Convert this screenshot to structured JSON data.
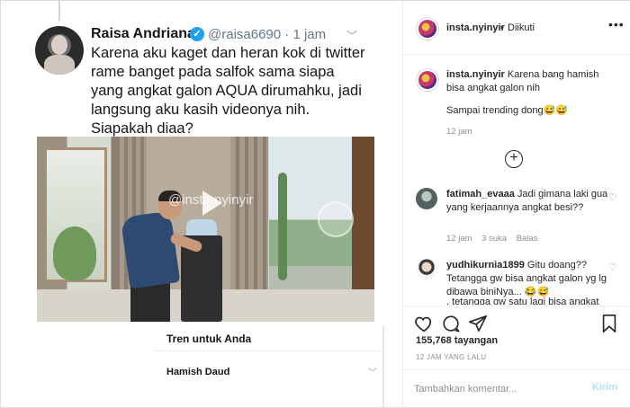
{
  "tweet": {
    "name": "Raisa Andriana",
    "handle": "@raisa6690 · 1 jam",
    "text": "Karena aku kaget dan heran kok di twitter rame banget pada salfok sama siapa yang angkat galon AQUA dirumahku, jadi langsung aku kasih videonya nih. Siapakah diaa?",
    "video_watermark": "@insta.nyinyir"
  },
  "trends": {
    "title": "Tren untuk Anda",
    "item": "Hamish Daud"
  },
  "header": {
    "username": "insta.nyinyir",
    "separator": "•",
    "follow_status": "Diikuti",
    "more": "•••"
  },
  "caption": {
    "username": "insta.nyinyir",
    "text": "Karena bang hamish bisa angkat galon nih",
    "extra": "Sampai trending dong😅😅",
    "time": "12 jam"
  },
  "comments": [
    {
      "username": "fatimah_evaaa",
      "text": "Jadi gimana laki gua yang kerjaannya angkat besi??",
      "time": "12 jam",
      "likes": "3 suka",
      "reply": "Balas"
    },
    {
      "username": "yudhikurnia1899",
      "text": "Gitu doang?? Tetangga gw bisa angkat galon yg lg dibawa biniNya... 😂😅",
      "overflow": ", tetangga gw satu lagi bisa angkat"
    }
  ],
  "stats": {
    "views": "155,768 tayangan",
    "time_ago": "12 JAM YANG LALU"
  },
  "comment_box": {
    "placeholder": "Tambahkan komentar...",
    "post_label": "Kirim"
  },
  "colors": {
    "verified": "#1da1f2",
    "post_disabled": "#b2dffc",
    "muted": "#8e8e8e"
  }
}
